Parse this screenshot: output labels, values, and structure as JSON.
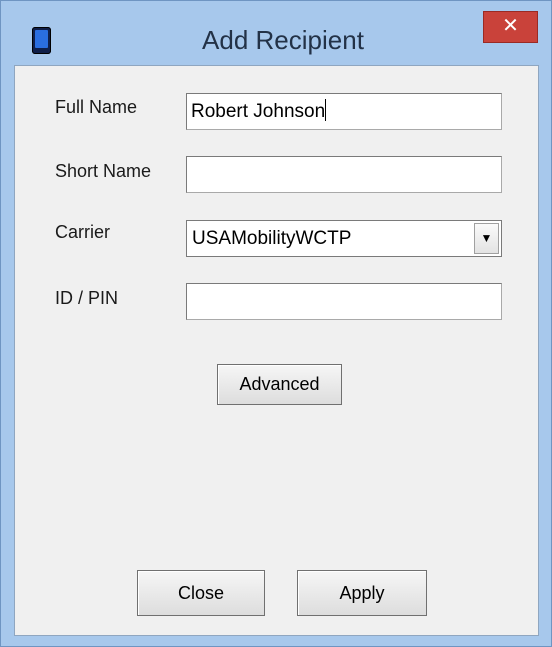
{
  "window": {
    "title": "Add Recipient",
    "close_glyph": "✕",
    "icon": "device-icon",
    "accent_color": "#a7c8ec",
    "close_color": "#c9423a"
  },
  "form": {
    "full_name": {
      "label": "Full Name",
      "value": "Robert Johnson"
    },
    "short_name": {
      "label": "Short Name",
      "value": ""
    },
    "carrier": {
      "label": "Carrier",
      "value": "USAMobilityWCTP",
      "arrow": "▼"
    },
    "id_pin": {
      "label": "ID / PIN",
      "value": ""
    }
  },
  "buttons": {
    "advanced": "Advanced",
    "close": "Close",
    "apply": "Apply"
  }
}
